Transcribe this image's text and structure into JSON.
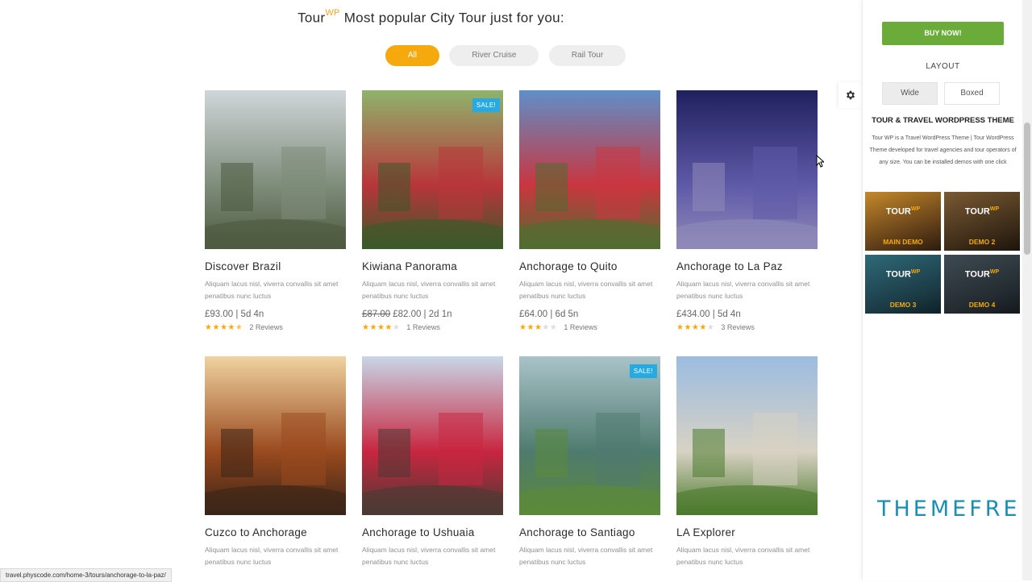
{
  "heading": {
    "brand": "Tour",
    "sup": "WP",
    "text": " Most popular City Tour just for you:"
  },
  "filters": [
    "All",
    "River Cruise",
    "Rail Tour"
  ],
  "tours": [
    {
      "title": "Discover Brazil",
      "desc": "Aliquam lacus nisl, viverra convallis sit amet penatibus nunc luctus",
      "price": "£93.00 | 5d 4n",
      "old": "",
      "stars": 4.5,
      "reviews": "2 Reviews",
      "sale": ""
    },
    {
      "title": "Kiwiana Panorama",
      "desc": "Aliquam lacus nisl, viverra convallis sit amet penatibus nunc luctus",
      "price": "£82.00 | 2d 1n",
      "old": "£87.00",
      "stars": 4,
      "reviews": "1 Reviews",
      "sale": "SALE!"
    },
    {
      "title": "Anchorage to Quito",
      "desc": "Aliquam lacus nisl, viverra convallis sit amet penatibus nunc luctus",
      "price": "£64.00 | 6d 5n",
      "old": "",
      "stars": 3,
      "reviews": "1 Reviews",
      "sale": ""
    },
    {
      "title": "Anchorage to La Paz",
      "desc": "Aliquam lacus nisl, viverra convallis sit amet penatibus nunc luctus",
      "price": "£434.00 | 5d 4n",
      "old": "",
      "stars": 4,
      "reviews": "3 Reviews",
      "sale": ""
    },
    {
      "title": "Cuzco to Anchorage",
      "desc": "Aliquam lacus nisl, viverra convallis sit amet penatibus nunc luctus",
      "price": "",
      "old": "",
      "stars": 0,
      "reviews": "",
      "sale": ""
    },
    {
      "title": "Anchorage to Ushuaia",
      "desc": "Aliquam lacus nisl, viverra convallis sit amet penatibus nunc luctus",
      "price": "",
      "old": "",
      "stars": 0,
      "reviews": "",
      "sale": ""
    },
    {
      "title": "Anchorage to Santiago",
      "desc": "Aliquam lacus nisl, viverra convallis sit amet penatibus nunc luctus",
      "price": "",
      "old": "",
      "stars": 0,
      "reviews": "",
      "sale": "SALE!"
    },
    {
      "title": "LA Explorer",
      "desc": "Aliquam lacus nisl, viverra convallis sit amet penatibus nunc luctus",
      "price": "",
      "old": "",
      "stars": 0,
      "reviews": "",
      "sale": ""
    }
  ],
  "panel": {
    "buy": "BUY NOW!",
    "layout_label": "LAYOUT",
    "wide": "Wide",
    "boxed": "Boxed",
    "theme_title": "TOUR & TRAVEL WORDPRESS THEME",
    "theme_desc": "Tour WP is a Travel WordPress Theme | Tour WordPress Theme developed for travel agencies and tour operators of any size. You can be installed demos with one click",
    "demo_logo": "TOUR",
    "demo_logo_sup": "WP",
    "demos": [
      "MAIN DEMO",
      "DEMO 2",
      "DEMO 3",
      "DEMO 4"
    ],
    "brand": "THEMEFRE"
  },
  "status_url": "travel.physcode.com/home-3/tours/anchorage-to-la-paz/",
  "colors": {
    "accent": "#f6a90c",
    "buy": "#6aab3a",
    "sale": "#27a9e1"
  }
}
